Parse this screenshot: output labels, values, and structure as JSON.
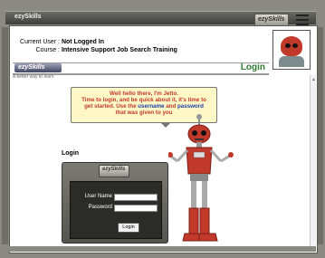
{
  "window": {
    "title": "ezySkills"
  },
  "brand": {
    "logo_text": "ezySkills",
    "tagline": "A better way to learn"
  },
  "user_info": {
    "current_user_label": "Current User :",
    "current_user_value": "Not Logged In",
    "course_label": "Course :",
    "course_value": "Intensive Support Job Search Training"
  },
  "page": {
    "title": "Login"
  },
  "speech": {
    "line1": "Well hello there, I'm Jetto.",
    "line2": "Time to login, and be quick about it, it's time to",
    "line3_prefix": "get started.  Use the ",
    "username_word": "username",
    "and_word": " and ",
    "password_word": "password",
    "line4": "that was given to you"
  },
  "login": {
    "heading": "Login",
    "username_label": "User Name",
    "password_label": "Password",
    "username_value": "",
    "password_value": "",
    "button_label": "Login"
  },
  "colors": {
    "accent_green": "#2e7d32",
    "speech_red": "#c0392b",
    "speech_blue": "#1a3cab",
    "bubble_bg": "#fef8c6"
  },
  "icons": {
    "corner": "window-grip-icon",
    "mascot": "robot-mascot"
  }
}
